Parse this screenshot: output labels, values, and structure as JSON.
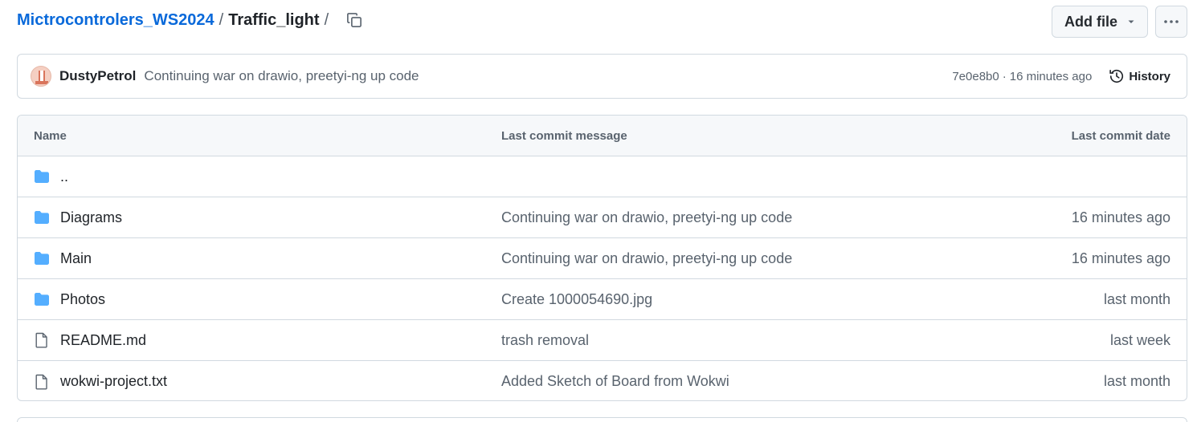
{
  "breadcrumb": {
    "repo": "Mictrocontrolers_WS2024",
    "separator": "/",
    "folder": "Traffic_light",
    "trailing_separator": "/"
  },
  "actions": {
    "add_file_label": "Add file",
    "more_label": "···"
  },
  "commit": {
    "author": "DustyPetrol",
    "message": "Continuing war on drawio, preetyi-ng up code",
    "hash": "7e0e8b0",
    "dot": "·",
    "time": "16 minutes ago",
    "history_label": "History"
  },
  "table": {
    "headers": {
      "name": "Name",
      "message": "Last commit message",
      "date": "Last commit date"
    },
    "rows": [
      {
        "type": "folder",
        "name": "..",
        "message": "",
        "date": ""
      },
      {
        "type": "folder",
        "name": "Diagrams",
        "message": "Continuing war on drawio, preetyi-ng up code",
        "date": "16 minutes ago"
      },
      {
        "type": "folder",
        "name": "Main",
        "message": "Continuing war on drawio, preetyi-ng up code",
        "date": "16 minutes ago"
      },
      {
        "type": "folder",
        "name": "Photos",
        "message": "Create 1000054690.jpg",
        "date": "last month"
      },
      {
        "type": "file",
        "name": "README.md",
        "message": "trash removal",
        "date": "last week"
      },
      {
        "type": "file",
        "name": "wokwi-project.txt",
        "message": "Added Sketch of Board from Wokwi",
        "date": "last month"
      }
    ]
  },
  "colors": {
    "link": "#0969da",
    "folder_icon": "#54aeff",
    "muted_text": "#59636e",
    "border": "#d1d9e0"
  },
  "icons": {
    "copy": "copy-icon",
    "dropdown": "triangle-down-icon",
    "more": "kebab-horizontal-icon",
    "history": "history-icon",
    "folder": "folder-icon",
    "file": "file-icon"
  }
}
